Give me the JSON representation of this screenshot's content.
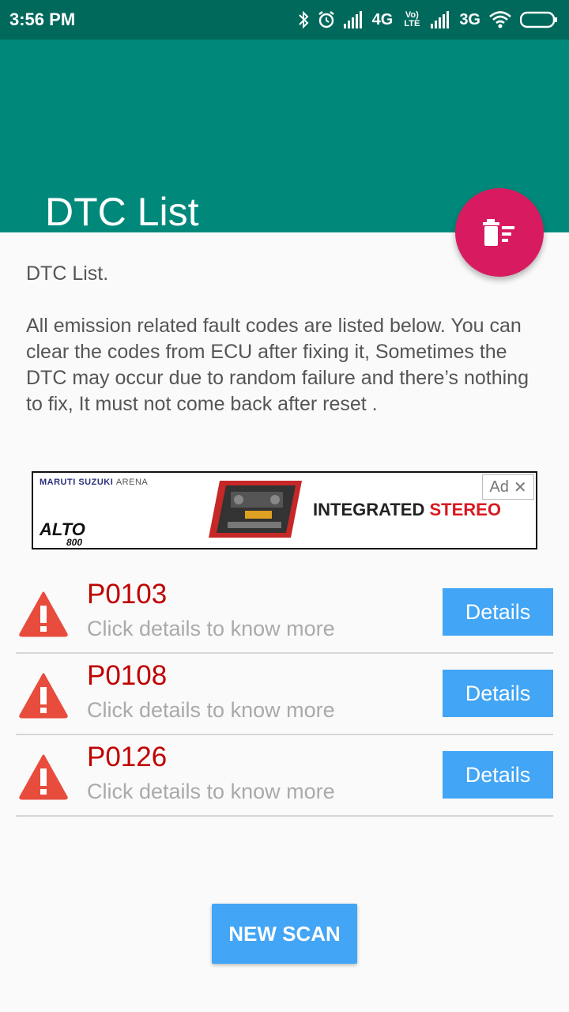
{
  "status_bar": {
    "time": "3:56 PM",
    "network_1": "4G",
    "volte": "Vo) LTE",
    "network_2": "3G",
    "icons": [
      "bluetooth-icon",
      "alarm-icon",
      "signal-icon",
      "wifi-icon",
      "battery-icon"
    ]
  },
  "toolbar": {
    "title": "DTC List"
  },
  "fab": {
    "icon": "clear-codes-icon"
  },
  "intro": {
    "heading": "DTC List.",
    "body": " All emission related fault codes are listed below. You can clear the codes from ECU after fixing it, Sometimes the DTC may occur due to random failure and there’s nothing to fix, It must not come back after reset ."
  },
  "ad": {
    "brand": "MARUTI SUZUKI",
    "brand_suffix": "ARENA",
    "model": "ALTO",
    "model_sub": "800",
    "headline_1": "INTEGRATED",
    "headline_2": "STEREO",
    "badge": "Ad",
    "close": "✕"
  },
  "dtc_items": [
    {
      "code": "P0103",
      "subtitle": "Click details to know more",
      "button": "Details"
    },
    {
      "code": "P0108",
      "subtitle": "Click details to know more",
      "button": "Details"
    },
    {
      "code": "P0126",
      "subtitle": "Click details to know more",
      "button": "Details"
    }
  ],
  "new_scan_label": "NEW SCAN",
  "colors": {
    "status_bar": "#00695c",
    "toolbar": "#00897b",
    "fab": "#d81b60",
    "button": "#42a5f5",
    "code_red": "#c00000",
    "warning": "#e84c3d"
  }
}
